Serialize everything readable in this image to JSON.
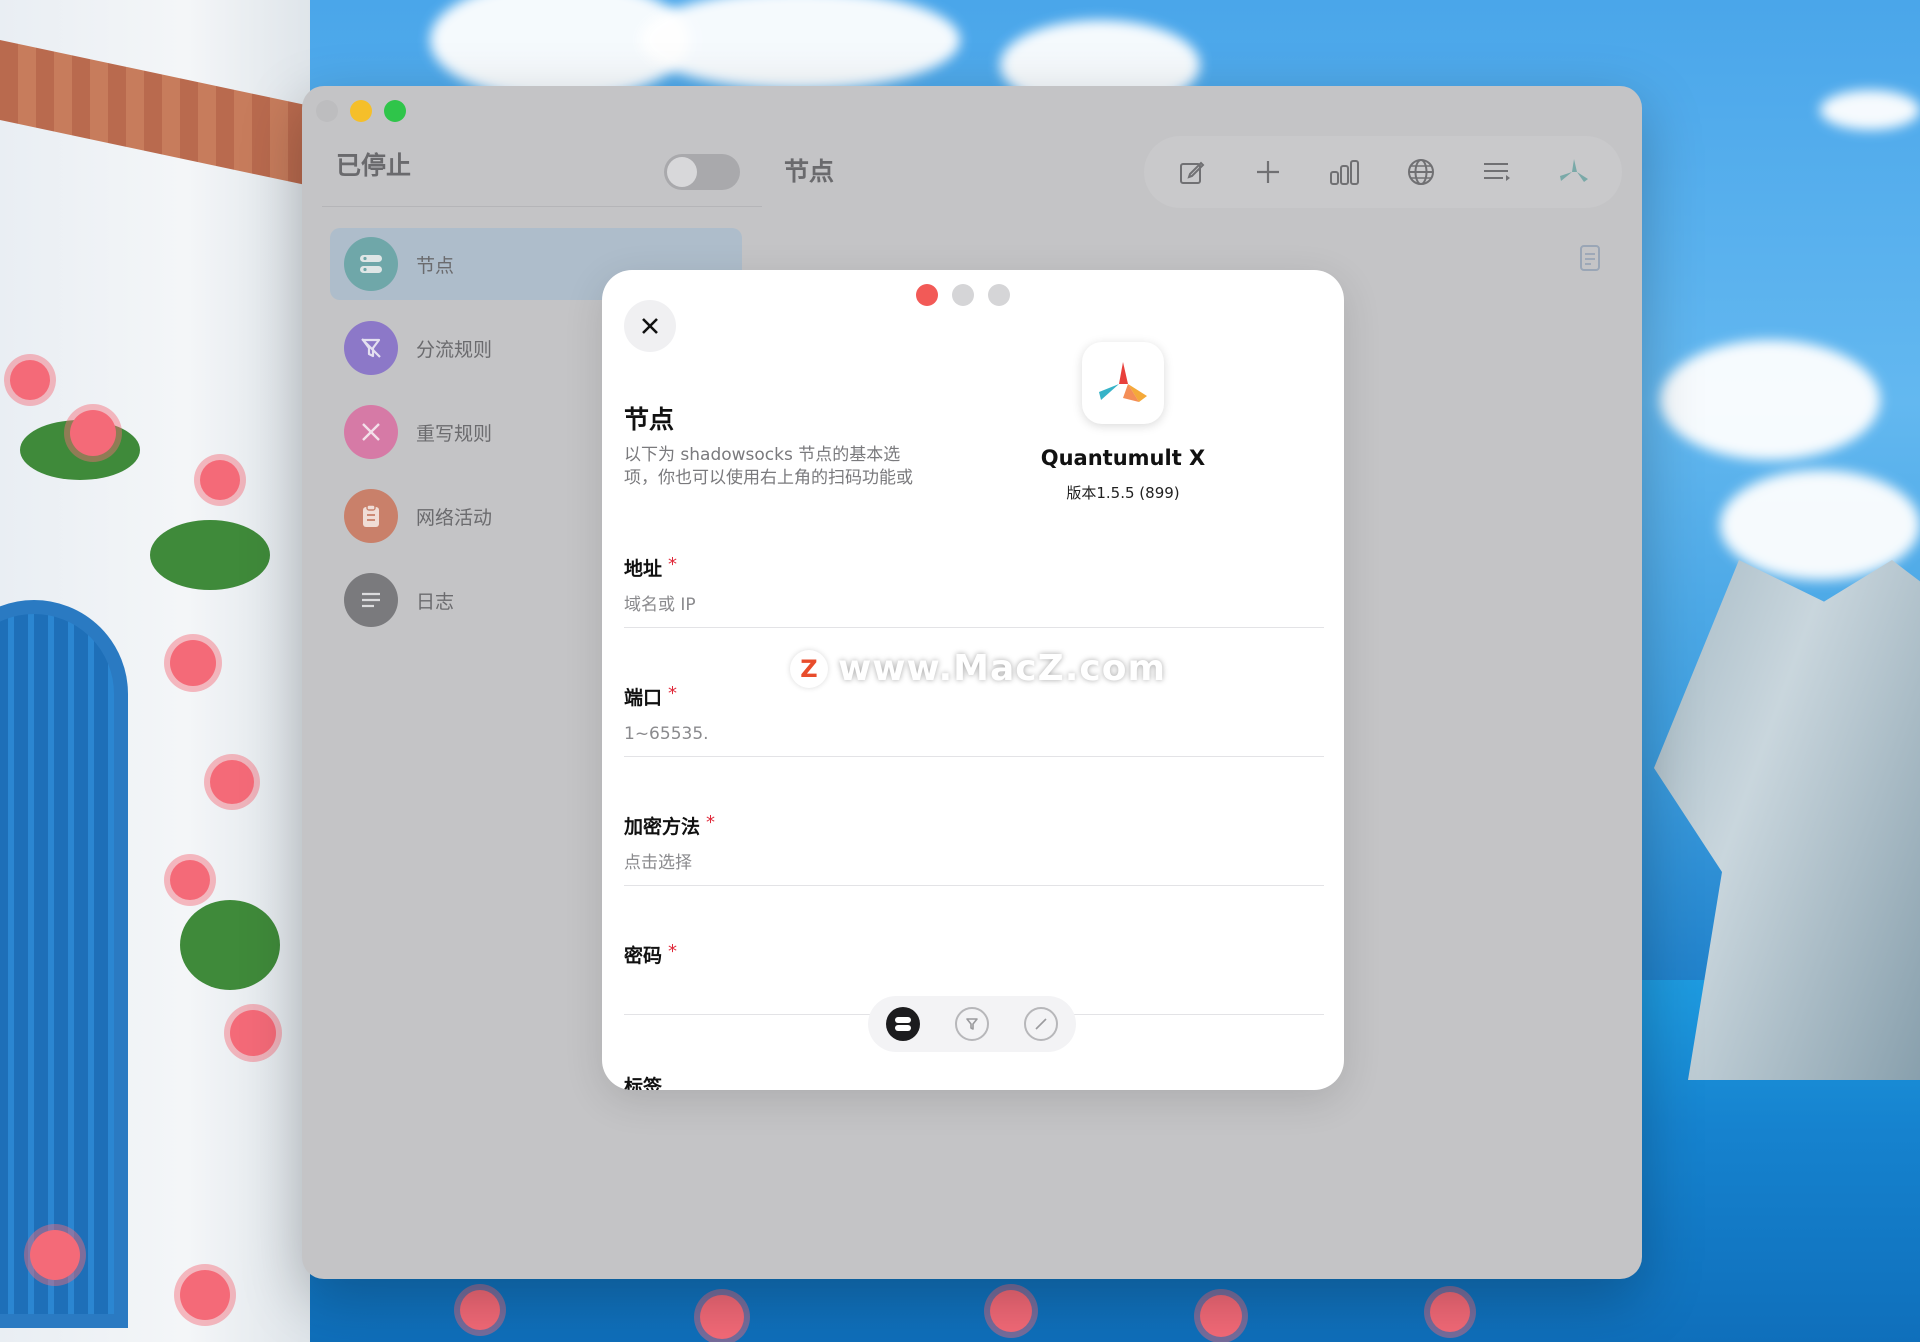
{
  "colors": {
    "accent_teal": "#6fa7a9",
    "rule_purple": "#8c78c8",
    "rewrite_pink": "#d67aa6",
    "activity_orange": "#c9806a",
    "log_gray": "#7a7a7d",
    "required_red": "#e0293a"
  },
  "sidebar": {
    "status_title": "已停止",
    "items": [
      {
        "label": "节点",
        "icon": "server-icon",
        "active": true
      },
      {
        "label": "分流规则",
        "icon": "filter-icon"
      },
      {
        "label": "重写规则",
        "icon": "scissors-icon"
      },
      {
        "label": "网络活动",
        "icon": "clipboard-icon"
      },
      {
        "label": "日志",
        "icon": "list-icon"
      }
    ]
  },
  "main": {
    "title": "节点",
    "toolbar": [
      "edit-icon",
      "plus-icon",
      "chart-icon",
      "globe-icon",
      "menu-icon",
      "app-logo-icon"
    ]
  },
  "modal": {
    "title": "节点",
    "description": "以下为 shadowsocks 节点的基本选项，你也可以使用右上角的扫码功能或节点 URI 添加。",
    "app_name": "Quantumult X",
    "app_version": "版本1.5.5 (899)",
    "fields": [
      {
        "label": "地址",
        "required": "*",
        "placeholder": "域名或 IP"
      },
      {
        "label": "端口",
        "required": "*",
        "placeholder": "1~65535."
      },
      {
        "label": "加密方法",
        "required": "*",
        "placeholder": "点击选择"
      },
      {
        "label": "密码",
        "required": "*",
        "placeholder": ""
      },
      {
        "label": "标签"
      }
    ]
  },
  "watermark": {
    "logo": "Z",
    "text": "www.MacZ.com"
  }
}
